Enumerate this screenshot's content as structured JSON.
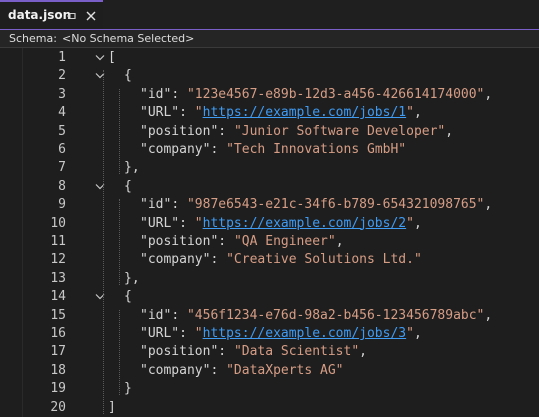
{
  "tab": {
    "title": "data.json"
  },
  "schema": {
    "label": "Schema:",
    "value": "<No Schema Selected>"
  },
  "lines": [
    {
      "num": "1",
      "indent": 0,
      "fold": true,
      "parts": [
        {
          "t": "[",
          "c": "punct"
        }
      ]
    },
    {
      "num": "2",
      "indent": 1,
      "fold": true,
      "parts": [
        {
          "t": "{",
          "c": "punct"
        }
      ]
    },
    {
      "num": "3",
      "indent": 2,
      "fold": false,
      "parts": [
        {
          "t": "\"id\"",
          "c": "key"
        },
        {
          "t": ": ",
          "c": "punct"
        },
        {
          "t": "\"123e4567-e89b-12d3-a456-426614174000\"",
          "c": "str"
        },
        {
          "t": ",",
          "c": "punct"
        }
      ]
    },
    {
      "num": "4",
      "indent": 2,
      "fold": false,
      "parts": [
        {
          "t": "\"URL\"",
          "c": "key"
        },
        {
          "t": ": ",
          "c": "punct"
        },
        {
          "t": "\"",
          "c": "str"
        },
        {
          "t": "https://example.com/jobs/1",
          "c": "link"
        },
        {
          "t": "\"",
          "c": "str"
        },
        {
          "t": ",",
          "c": "punct"
        }
      ]
    },
    {
      "num": "5",
      "indent": 2,
      "fold": false,
      "parts": [
        {
          "t": "\"position\"",
          "c": "key"
        },
        {
          "t": ": ",
          "c": "punct"
        },
        {
          "t": "\"Junior Software Developer\"",
          "c": "str"
        },
        {
          "t": ",",
          "c": "punct"
        }
      ]
    },
    {
      "num": "6",
      "indent": 2,
      "fold": false,
      "parts": [
        {
          "t": "\"company\"",
          "c": "key"
        },
        {
          "t": ": ",
          "c": "punct"
        },
        {
          "t": "\"Tech Innovations GmbH\"",
          "c": "str"
        }
      ]
    },
    {
      "num": "7",
      "indent": 1,
      "fold": false,
      "parts": [
        {
          "t": "},",
          "c": "punct"
        }
      ]
    },
    {
      "num": "8",
      "indent": 1,
      "fold": true,
      "parts": [
        {
          "t": "{",
          "c": "punct"
        }
      ]
    },
    {
      "num": "9",
      "indent": 2,
      "fold": false,
      "parts": [
        {
          "t": "\"id\"",
          "c": "key"
        },
        {
          "t": ": ",
          "c": "punct"
        },
        {
          "t": "\"987e6543-e21c-34f6-b789-654321098765\"",
          "c": "str"
        },
        {
          "t": ",",
          "c": "punct"
        }
      ]
    },
    {
      "num": "10",
      "indent": 2,
      "fold": false,
      "parts": [
        {
          "t": "\"URL\"",
          "c": "key"
        },
        {
          "t": ": ",
          "c": "punct"
        },
        {
          "t": "\"",
          "c": "str"
        },
        {
          "t": "https://example.com/jobs/2",
          "c": "link"
        },
        {
          "t": "\"",
          "c": "str"
        },
        {
          "t": ",",
          "c": "punct"
        }
      ]
    },
    {
      "num": "11",
      "indent": 2,
      "fold": false,
      "parts": [
        {
          "t": "\"position\"",
          "c": "key"
        },
        {
          "t": ": ",
          "c": "punct"
        },
        {
          "t": "\"QA Engineer\"",
          "c": "str"
        },
        {
          "t": ",",
          "c": "punct"
        }
      ]
    },
    {
      "num": "12",
      "indent": 2,
      "fold": false,
      "parts": [
        {
          "t": "\"company\"",
          "c": "key"
        },
        {
          "t": ": ",
          "c": "punct"
        },
        {
          "t": "\"Creative Solutions Ltd.\"",
          "c": "str"
        }
      ]
    },
    {
      "num": "13",
      "indent": 1,
      "fold": false,
      "parts": [
        {
          "t": "},",
          "c": "punct"
        }
      ]
    },
    {
      "num": "14",
      "indent": 1,
      "fold": true,
      "parts": [
        {
          "t": "{",
          "c": "punct"
        }
      ]
    },
    {
      "num": "15",
      "indent": 2,
      "fold": false,
      "parts": [
        {
          "t": "\"id\"",
          "c": "key"
        },
        {
          "t": ": ",
          "c": "punct"
        },
        {
          "t": "\"456f1234-e76d-98a2-b456-123456789abc\"",
          "c": "str"
        },
        {
          "t": ",",
          "c": "punct"
        }
      ]
    },
    {
      "num": "16",
      "indent": 2,
      "fold": false,
      "parts": [
        {
          "t": "\"URL\"",
          "c": "key"
        },
        {
          "t": ": ",
          "c": "punct"
        },
        {
          "t": "\"",
          "c": "str"
        },
        {
          "t": "https://example.com/jobs/3",
          "c": "link"
        },
        {
          "t": "\"",
          "c": "str"
        },
        {
          "t": ",",
          "c": "punct"
        }
      ]
    },
    {
      "num": "17",
      "indent": 2,
      "fold": false,
      "parts": [
        {
          "t": "\"position\"",
          "c": "key"
        },
        {
          "t": ": ",
          "c": "punct"
        },
        {
          "t": "\"Data Scientist\"",
          "c": "str"
        },
        {
          "t": ",",
          "c": "punct"
        }
      ]
    },
    {
      "num": "18",
      "indent": 2,
      "fold": false,
      "parts": [
        {
          "t": "\"company\"",
          "c": "key"
        },
        {
          "t": ": ",
          "c": "punct"
        },
        {
          "t": "\"DataXperts AG\"",
          "c": "str"
        }
      ]
    },
    {
      "num": "19",
      "indent": 1,
      "fold": false,
      "parts": [
        {
          "t": "}",
          "c": "punct"
        }
      ]
    },
    {
      "num": "20",
      "indent": 0,
      "fold": false,
      "parts": [
        {
          "t": "]",
          "c": "punct"
        }
      ]
    }
  ],
  "colors": {
    "accent": "#7a5fc8",
    "string": "#d69d85",
    "link": "#3f9cf5",
    "text": "#d4d4d4",
    "background": "#1e1e1e"
  }
}
